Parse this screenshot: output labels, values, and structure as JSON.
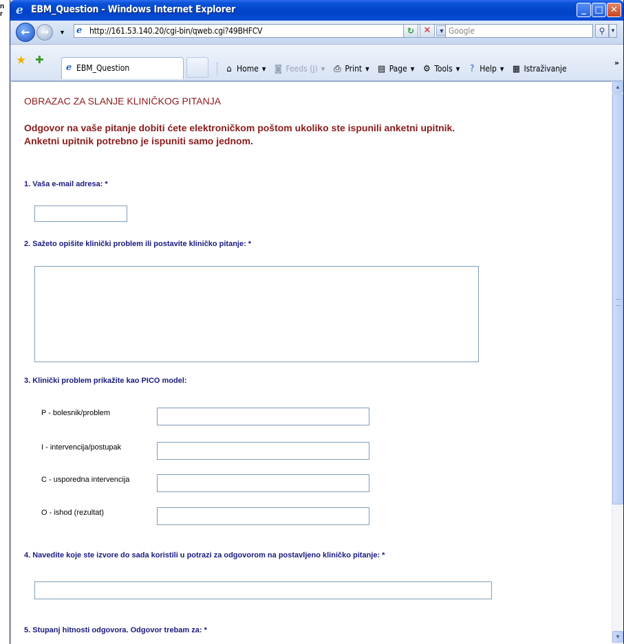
{
  "desktop": {
    "glyph_text": "n\nr"
  },
  "window": {
    "title": "EBM_Question - Windows Internet Explorer",
    "buttons": {
      "minimize": "_",
      "maximize": "□",
      "close": "✕"
    }
  },
  "address_bar": {
    "url": "http://161.53.140.20/cgi-bin/qweb.cgi?49BHFCV",
    "search_placeholder": "Google"
  },
  "tabs": [
    {
      "label": "EBM_Question"
    }
  ],
  "command_bar": {
    "home": "Home",
    "feeds": "Feeds (J)",
    "print": "Print",
    "page": "Page",
    "tools": "Tools",
    "help": "Help",
    "research": "Istraživanje"
  },
  "form": {
    "heading": "OBRAZAC ZA SLANJE KLINIČKOG PITANJA",
    "intro_line1": "Odgovor na vaše pitanje dobiti ćete elektroničkom poštom ukoliko ste ispunili anketni upitnik.",
    "intro_line2": "Anketni upitnik potrebno je ispuniti samo jednom.",
    "q1": "1. Vaša e-mail adresa: *",
    "q2": "2. Sažeto opišite klinički problem ili postavite kliničko pitanje: *",
    "q3": "3. Klinički problem prikažite kao PICO model:",
    "pico": [
      {
        "label": "P - bolesnik/problem",
        "value": ""
      },
      {
        "label": "I - intervencija/postupak",
        "value": ""
      },
      {
        "label": "C - usporedna intervencija",
        "value": ""
      },
      {
        "label": "O - ishod (rezultat)",
        "value": ""
      }
    ],
    "q4": "4. Navedite koje ste izvore do sada koristili u potrazi za odgovorom na postavljeno kliničko pitanje: *",
    "q5": "5. Stupanj hitnosti odgovora. Odgovor trebam za: *",
    "email_value": "",
    "problem_value": "",
    "sources_value": ""
  },
  "colors": {
    "heading": "#8b1a1a",
    "question": "#1a1a80",
    "titlebar": "#0042c8"
  }
}
